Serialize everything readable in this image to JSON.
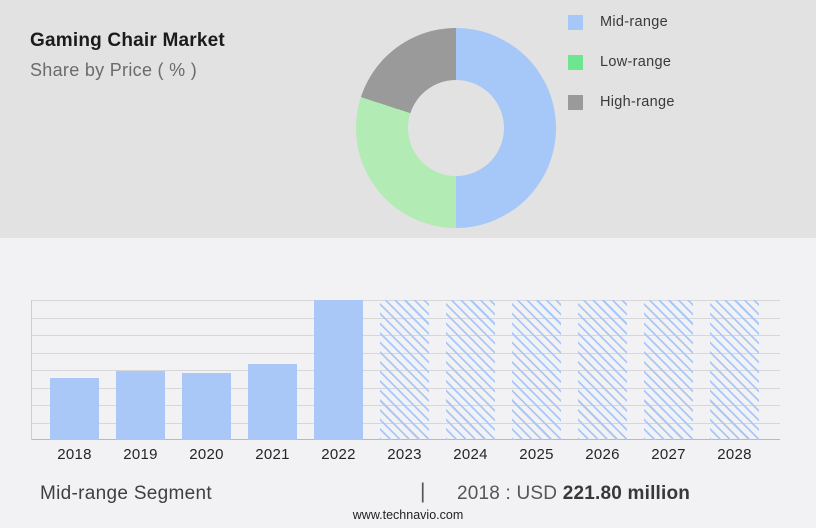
{
  "header": {
    "title": "Gaming Chair Market",
    "subtitle": "Share by Price ( % )"
  },
  "chart_data": [
    {
      "type": "pie",
      "subtype": "donut",
      "title": "Gaming Chair Market — Share by Price ( % )",
      "labels": [
        "Mid-range",
        "Low-range",
        "High-range"
      ],
      "values": [
        50,
        30,
        20
      ],
      "colors": [
        "#a6c8f8",
        "#b2ecb4",
        "#9a9a9a"
      ],
      "legend_colors": [
        "#a6c8f8",
        "#6ee68e",
        "#9a9a9a"
      ],
      "legend_position": "right",
      "start_angle_deg": 0,
      "direction": "clockwise"
    },
    {
      "type": "bar",
      "categories": [
        "2018",
        "2019",
        "2020",
        "2021",
        "2022",
        "2023",
        "2024",
        "2025",
        "2026",
        "2027",
        "2028"
      ],
      "values_pct_of_max": [
        44,
        49,
        48,
        54,
        100,
        100,
        100,
        100,
        100,
        100,
        100
      ],
      "historical_solid": [
        "2018",
        "2019",
        "2020",
        "2021",
        "2022"
      ],
      "forecast_hatched": [
        "2023",
        "2024",
        "2025",
        "2026",
        "2027",
        "2028"
      ],
      "known_point": {
        "year": "2018",
        "value": "USD 221.80 million"
      },
      "bar_color": "#a9c8f8",
      "gridline_count": 9,
      "grid": true,
      "xlabel": "",
      "ylabel": ""
    }
  ],
  "footer": {
    "segment_label": "Mid-range Segment",
    "separator": "|",
    "value_prefix": "2018 : USD ",
    "value_bold": "221.80 million",
    "website": "www.technavio.com"
  }
}
